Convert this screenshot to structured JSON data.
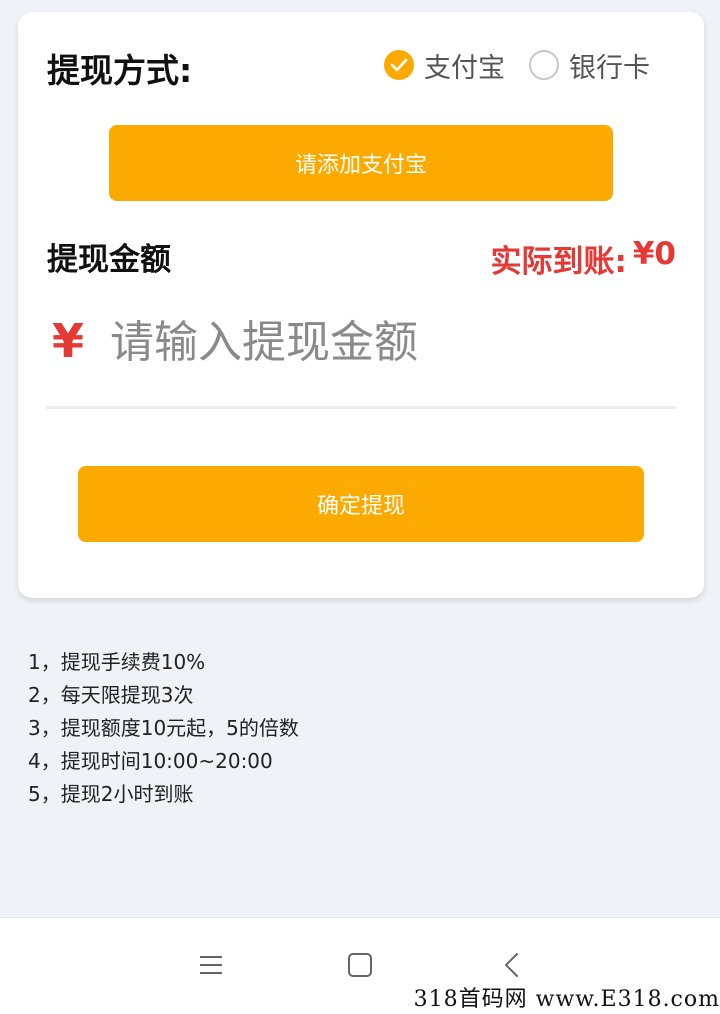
{
  "withdraw_method": {
    "title": "提现方式:",
    "options": [
      {
        "label": "支付宝",
        "checked": true
      },
      {
        "label": "银行卡",
        "checked": false
      }
    ]
  },
  "add_alipay_button": "请添加支付宝",
  "amount": {
    "title": "提现金额",
    "actual_label": "实际到账:",
    "actual_value": "¥0",
    "currency_symbol": "¥",
    "placeholder": "请输入提现金额"
  },
  "confirm_button": "确定提现",
  "rules": [
    "1，提现手续费10%",
    "2，每天限提现3次",
    "3，提现额度10元起，5的倍数",
    "4，提现时间10:00~20:00",
    "5，提现2小时到账"
  ],
  "watermark": "318首码网 www.E318.com",
  "colors": {
    "accent": "#fcaa00",
    "warning_red": "#e53935",
    "background": "#eff2f7"
  },
  "icons": {
    "check": "check-icon",
    "nav_menu": "menu-icon",
    "nav_home": "home-icon",
    "nav_back": "back-icon"
  }
}
